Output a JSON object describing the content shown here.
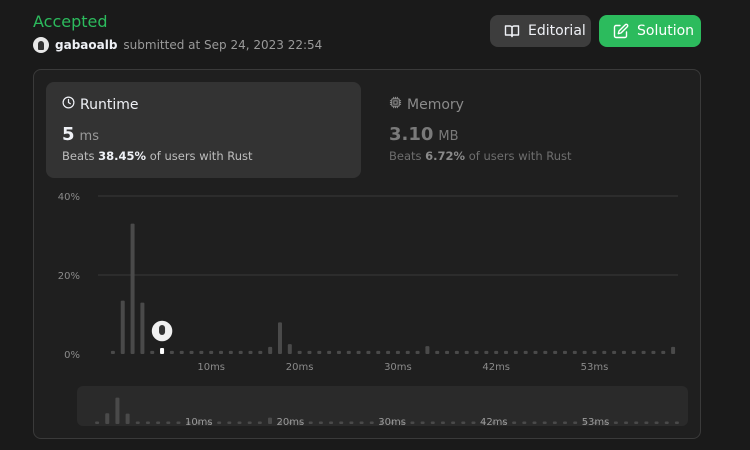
{
  "submission": {
    "status": "Accepted",
    "username": "gabaoalb",
    "submitted_text": "submitted at Sep 24, 2023 22:54"
  },
  "buttons": {
    "editorial": "Editorial",
    "solution": "Solution"
  },
  "runtime": {
    "label": "Runtime",
    "value": "5",
    "unit": "ms",
    "beats_prefix": "Beats",
    "beats_pct": "38.45%",
    "beats_suffix": "of users with Rust"
  },
  "memory": {
    "label": "Memory",
    "value": "3.10",
    "unit": "MB",
    "beats_prefix": "Beats",
    "beats_pct": "6.72%",
    "beats_suffix": "of users with Rust"
  },
  "colors": {
    "accent": "#2cbb5d",
    "bar": "#4a4a4a",
    "grid": "#3a3a3a"
  },
  "chart_data": {
    "type": "bar",
    "xlabel": "",
    "ylabel": "",
    "ylim": [
      0,
      40
    ],
    "y_ticks": [
      "0%",
      "20%",
      "40%"
    ],
    "x_ticks": [
      {
        "label": "10ms",
        "bin": 10
      },
      {
        "label": "20ms",
        "bin": 19
      },
      {
        "label": "30ms",
        "bin": 29
      },
      {
        "label": "42ms",
        "bin": 39
      },
      {
        "label": "53ms",
        "bin": 49
      }
    ],
    "values": [
      0.8,
      13.5,
      33,
      13,
      0.8,
      0.8,
      0.8,
      0.8,
      0.8,
      0.8,
      0.8,
      0.8,
      0.8,
      0.8,
      0.8,
      0.8,
      1.8,
      8,
      2.5,
      0.8,
      0.8,
      0.8,
      0.8,
      0.8,
      0.8,
      0.8,
      0.8,
      0.8,
      0.8,
      0.8,
      0.8,
      0.8,
      2,
      0.8,
      0.8,
      0.8,
      0.8,
      0.8,
      0.8,
      0.8,
      0.8,
      0.8,
      0.8,
      0.8,
      0.8,
      0.8,
      0.8,
      0.8,
      0.8,
      0.8,
      0.8,
      0.8,
      0.8,
      0.8,
      0.8,
      0.8,
      0.8,
      1.8
    ],
    "user_bin": 5
  }
}
